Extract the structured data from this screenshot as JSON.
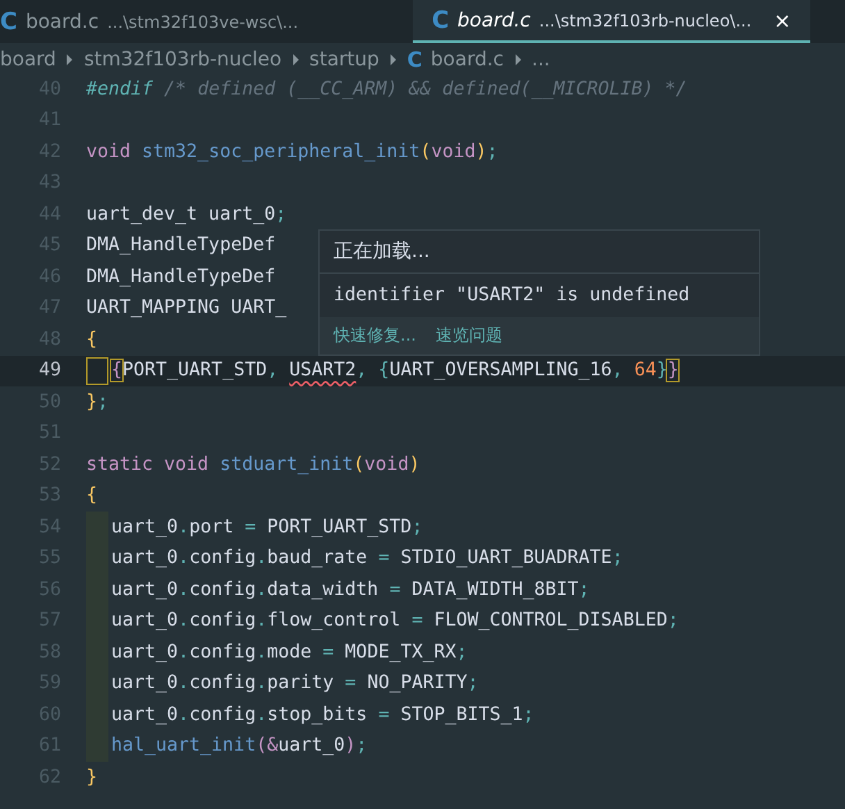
{
  "tabs": [
    {
      "icon": "C",
      "name": "board.c",
      "path": "...\\stm32f103ve-wsc\\...",
      "selected": false
    },
    {
      "icon": "C",
      "name": "board.c",
      "path": "...\\stm32f103rb-nucleo\\...",
      "selected": true,
      "close": "×"
    }
  ],
  "breadcrumb": [
    {
      "label": "board"
    },
    {
      "label": "stm32f103rb-nucleo"
    },
    {
      "label": "startup"
    },
    {
      "icon": "C",
      "label": "board.c"
    },
    {
      "label": "..."
    }
  ],
  "lines": [
    {
      "number": "40",
      "current": false,
      "guide": false,
      "tokens": [
        {
          "text": "#endif",
          "kind": "directive"
        },
        {
          "text": " /* defined (__CC_ARM) && defined(__MICROLIB) */",
          "kind": "comment"
        }
      ]
    },
    {
      "number": "41",
      "current": false,
      "guide": false
    },
    {
      "number": "42",
      "current": false,
      "guide": false,
      "tokens": [
        {
          "text": "void ",
          "kind": "keyword"
        },
        {
          "text": "stm32_soc_peripheral_init",
          "kind": "function"
        },
        {
          "text": "(",
          "kind": "bracket"
        },
        {
          "text": "void",
          "kind": "keyword"
        },
        {
          "text": ")",
          "kind": "bracket"
        },
        {
          "text": ";",
          "kind": "punct"
        }
      ]
    },
    {
      "number": "43",
      "current": false,
      "guide": false
    },
    {
      "number": "44",
      "current": false,
      "guide": false,
      "tokens": [
        {
          "text": "uart_dev_t uart_0",
          "kind": "plain"
        },
        {
          "text": ";",
          "kind": "punct"
        }
      ]
    },
    {
      "number": "45",
      "current": false,
      "guide": false,
      "tokens": [
        {
          "text": "DMA_HandleTypeDef",
          "kind": "plain"
        }
      ]
    },
    {
      "number": "46",
      "current": false,
      "guide": false,
      "tokens": [
        {
          "text": "DMA_HandleTypeDef",
          "kind": "plain"
        }
      ]
    },
    {
      "number": "47",
      "current": false,
      "guide": false,
      "tokens": [
        {
          "text": "UART_MAPPING UART_",
          "kind": "plain"
        }
      ]
    },
    {
      "number": "48",
      "current": false,
      "guide": false,
      "tokens": [
        {
          "text": "{",
          "kind": "bracket"
        }
      ]
    },
    {
      "number": "49",
      "current": true,
      "guide": true,
      "tokens": [
        {
          "text": "{",
          "kind": "match"
        },
        {
          "text": "PORT_UART_STD",
          "kind": "plain"
        },
        {
          "text": ", ",
          "kind": "punct"
        },
        {
          "text": "USART2",
          "kind": "error"
        },
        {
          "text": ", {",
          "kind": "punct"
        },
        {
          "text": "UART_OVERSAMPLING_16",
          "kind": "plain"
        },
        {
          "text": ", ",
          "kind": "punct"
        },
        {
          "text": "64",
          "kind": "number"
        },
        {
          "text": "}",
          "kind": "punct"
        },
        {
          "text": "}",
          "kind": "match"
        }
      ]
    },
    {
      "number": "50",
      "current": false,
      "guide": false,
      "tokens": [
        {
          "text": "}",
          "kind": "bracket"
        },
        {
          "text": ";",
          "kind": "punct"
        }
      ]
    },
    {
      "number": "51",
      "current": false,
      "guide": false
    },
    {
      "number": "52",
      "current": false,
      "guide": false,
      "tokens": [
        {
          "text": "static void ",
          "kind": "keyword"
        },
        {
          "text": "stduart_init",
          "kind": "function"
        },
        {
          "text": "(",
          "kind": "bracket"
        },
        {
          "text": "void",
          "kind": "keyword"
        },
        {
          "text": ")",
          "kind": "bracket"
        }
      ]
    },
    {
      "number": "53",
      "current": false,
      "guide": false,
      "tokens": [
        {
          "text": "{",
          "kind": "bracket"
        }
      ]
    },
    {
      "number": "54",
      "current": false,
      "guide": true,
      "tokens": [
        {
          "text": "uart_0",
          "kind": "plain"
        },
        {
          "text": ".",
          "kind": "punct"
        },
        {
          "text": "port ",
          "kind": "plain"
        },
        {
          "text": "=",
          "kind": "punct"
        },
        {
          "text": " PORT_UART_STD",
          "kind": "plain"
        },
        {
          "text": ";",
          "kind": "punct"
        }
      ]
    },
    {
      "number": "55",
      "current": false,
      "guide": true,
      "tokens": [
        {
          "text": "uart_0",
          "kind": "plain"
        },
        {
          "text": ".",
          "kind": "punct"
        },
        {
          "text": "config",
          "kind": "plain"
        },
        {
          "text": ".",
          "kind": "punct"
        },
        {
          "text": "baud_rate ",
          "kind": "plain"
        },
        {
          "text": "=",
          "kind": "punct"
        },
        {
          "text": " STDIO_UART_BUADRATE",
          "kind": "plain"
        },
        {
          "text": ";",
          "kind": "punct"
        }
      ]
    },
    {
      "number": "56",
      "current": false,
      "guide": true,
      "tokens": [
        {
          "text": "uart_0",
          "kind": "plain"
        },
        {
          "text": ".",
          "kind": "punct"
        },
        {
          "text": "config",
          "kind": "plain"
        },
        {
          "text": ".",
          "kind": "punct"
        },
        {
          "text": "data_width ",
          "kind": "plain"
        },
        {
          "text": "=",
          "kind": "punct"
        },
        {
          "text": " DATA_WIDTH_8BIT",
          "kind": "plain"
        },
        {
          "text": ";",
          "kind": "punct"
        }
      ]
    },
    {
      "number": "57",
      "current": false,
      "guide": true,
      "tokens": [
        {
          "text": "uart_0",
          "kind": "plain"
        },
        {
          "text": ".",
          "kind": "punct"
        },
        {
          "text": "config",
          "kind": "plain"
        },
        {
          "text": ".",
          "kind": "punct"
        },
        {
          "text": "flow_control ",
          "kind": "plain"
        },
        {
          "text": "=",
          "kind": "punct"
        },
        {
          "text": " FLOW_CONTROL_DISABLED",
          "kind": "plain"
        },
        {
          "text": ";",
          "kind": "punct"
        }
      ]
    },
    {
      "number": "58",
      "current": false,
      "guide": true,
      "tokens": [
        {
          "text": "uart_0",
          "kind": "plain"
        },
        {
          "text": ".",
          "kind": "punct"
        },
        {
          "text": "config",
          "kind": "plain"
        },
        {
          "text": ".",
          "kind": "punct"
        },
        {
          "text": "mode ",
          "kind": "plain"
        },
        {
          "text": "=",
          "kind": "punct"
        },
        {
          "text": " MODE_TX_RX",
          "kind": "plain"
        },
        {
          "text": ";",
          "kind": "punct"
        }
      ]
    },
    {
      "number": "59",
      "current": false,
      "guide": true,
      "tokens": [
        {
          "text": "uart_0",
          "kind": "plain"
        },
        {
          "text": ".",
          "kind": "punct"
        },
        {
          "text": "config",
          "kind": "plain"
        },
        {
          "text": ".",
          "kind": "punct"
        },
        {
          "text": "parity ",
          "kind": "plain"
        },
        {
          "text": "=",
          "kind": "punct"
        },
        {
          "text": " NO_PARITY",
          "kind": "plain"
        },
        {
          "text": ";",
          "kind": "punct"
        }
      ]
    },
    {
      "number": "60",
      "current": false,
      "guide": true,
      "tokens": [
        {
          "text": "uart_0",
          "kind": "plain"
        },
        {
          "text": ".",
          "kind": "punct"
        },
        {
          "text": "config",
          "kind": "plain"
        },
        {
          "text": ".",
          "kind": "punct"
        },
        {
          "text": "stop_bits ",
          "kind": "plain"
        },
        {
          "text": "=",
          "kind": "punct"
        },
        {
          "text": " STOP_BITS_1",
          "kind": "plain"
        },
        {
          "text": ";",
          "kind": "punct"
        }
      ]
    },
    {
      "number": "61",
      "current": false,
      "guide": true,
      "tokens": [
        {
          "text": "hal_uart_init",
          "kind": "function"
        },
        {
          "text": "(&",
          "kind": "keyword"
        },
        {
          "text": "uart_0",
          "kind": "plain"
        },
        {
          "text": ")",
          "kind": "keyword"
        },
        {
          "text": ";",
          "kind": "punct"
        }
      ]
    },
    {
      "number": "62",
      "current": false,
      "guide": false,
      "tokens": [
        {
          "text": "}",
          "kind": "bracket"
        }
      ]
    }
  ],
  "hover": {
    "title": "正在加载...",
    "message": "identifier \"USART2\" is undefined",
    "actions": [
      "快速修复...",
      "速览问题"
    ]
  }
}
